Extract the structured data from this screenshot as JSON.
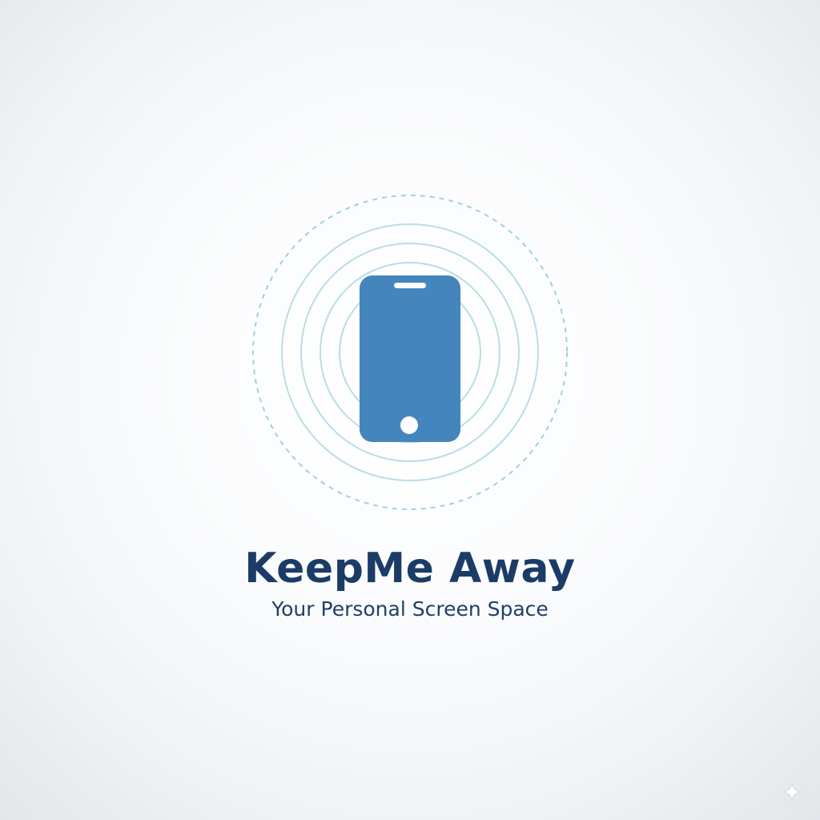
{
  "app": {
    "title": "KeepMe Away",
    "tagline": "Your Personal Screen Space"
  },
  "logo": {
    "icon": "smartphone-icon",
    "rings_icon": "signal-rings-icon"
  },
  "colors": {
    "phone": "#4585bd",
    "phone_details": "#ffffff",
    "rings": "#b9dde6",
    "dashed_ring": "#9fd0df",
    "title": "#1b3c67",
    "tagline": "#1f3f68",
    "sparkle": "#ffffff"
  },
  "corner": {
    "icon": "sparkle-icon"
  }
}
